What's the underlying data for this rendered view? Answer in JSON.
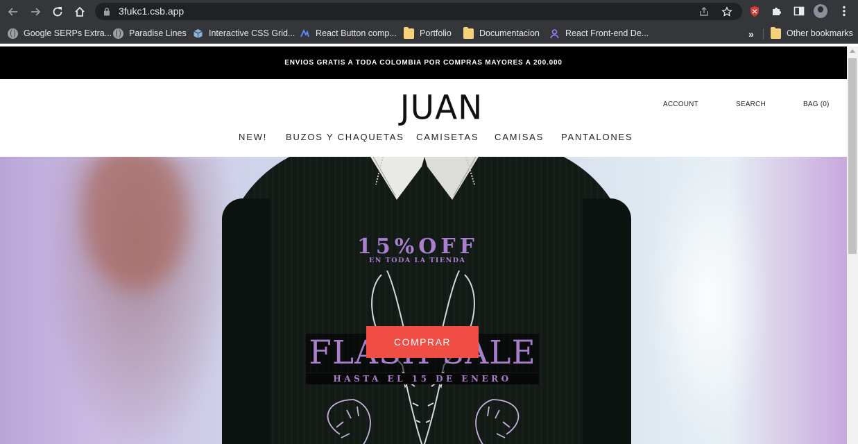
{
  "browser": {
    "url": "3fukc1.csb.app",
    "bookmarks": [
      {
        "label": "Google SERPs Extra...",
        "icon": "globe-icon"
      },
      {
        "label": "Paradise Lines",
        "icon": "globe-icon"
      },
      {
        "label": "Interactive CSS Grid...",
        "icon": "cube-icon"
      },
      {
        "label": "React Button comp...",
        "icon": "react-icon"
      },
      {
        "label": "Portfolio",
        "icon": "folder-icon"
      },
      {
        "label": "Documentacion",
        "icon": "folder-icon"
      },
      {
        "label": "React Front-end De...",
        "icon": "person-icon"
      }
    ],
    "more_bookmarks": "»",
    "other_bookmarks": "Other bookmarks"
  },
  "promo": {
    "text": "ENVIOS GRATIS A TODA COLOMBIA POR COMPRAS MAYORES A 200.000"
  },
  "header": {
    "logo": "JUAN",
    "account": "ACCOUNT",
    "search": "SEARCH",
    "bag": "BAG (0)"
  },
  "nav": {
    "items": [
      "NEW!",
      "BUZOS Y CHAQUETAS",
      "CAMISETAS",
      "CAMISAS",
      "PANTALONES"
    ]
  },
  "hero": {
    "offer": "15%OFF",
    "offer_sub": "EN TODA LA TIENDA",
    "headline": "FLASH SALE",
    "headline_sub": "HASTA EL 15 DE ENERO",
    "cta": "COMPRAR"
  },
  "colors": {
    "accent": "#f04e45",
    "promo_bar": "#000000",
    "offer_text": "#a97fcf"
  }
}
